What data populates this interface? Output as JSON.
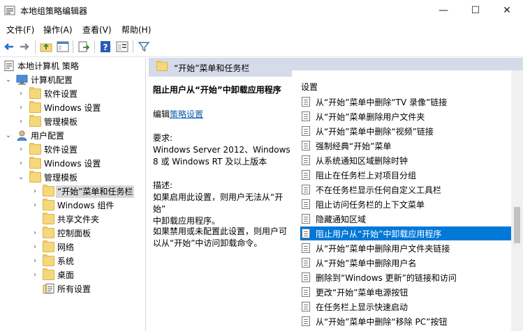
{
  "window": {
    "title": "本地组策略编辑器",
    "controls": {
      "minimize": "—",
      "maximize": "☐",
      "close": "✕"
    }
  },
  "menu": [
    {
      "label": "文件(F)"
    },
    {
      "label": "操作(A)"
    },
    {
      "label": "查看(V)"
    },
    {
      "label": "帮助(H)"
    }
  ],
  "toolbar": {
    "icons": [
      "back-arrow-icon",
      "forward-arrow-icon",
      "up-folder-icon",
      "show-hide-tree-icon",
      "export-list-icon",
      "help-icon",
      "properties-icon",
      "filter-icon"
    ]
  },
  "tree": {
    "items": [
      {
        "label": "本地计算机 策略"
      },
      {
        "label": "计算机配置"
      },
      {
        "label": "软件设置"
      },
      {
        "label": "Windows 设置"
      },
      {
        "label": "管理模板"
      },
      {
        "label": "用户配置"
      },
      {
        "label": "软件设置"
      },
      {
        "label": "Windows 设置"
      },
      {
        "label": "管理模板"
      },
      {
        "label": "“开始”菜单和任务栏"
      },
      {
        "label": "Windows 组件"
      },
      {
        "label": "共享文件夹"
      },
      {
        "label": "控制面板"
      },
      {
        "label": "网络"
      },
      {
        "label": "系统"
      },
      {
        "label": "桌面"
      },
      {
        "label": "所有设置"
      }
    ]
  },
  "right_header": {
    "title": "“开始”菜单和任务栏"
  },
  "description": {
    "title": "阻止用户从“开始”中卸载应用程序",
    "edit_prefix": "编辑",
    "edit_link": "策略设置",
    "req_label": "要求:",
    "req_line1": "Windows Server 2012、Windows",
    "req_line2": "8 或 Windows RT 及以上版本",
    "desc_label": "描述:",
    "desc_line1": "如果启用此设置，则用户无法从“开始”",
    "desc_line2": "中卸载应用程序。",
    "desc2_line1": "如果禁用或未配置此设置，则用户可",
    "desc2_line2": "以从“开始”中访问卸载命令。"
  },
  "settings": {
    "header": "设置",
    "items": [
      {
        "label": "从“开始”菜单中删除“TV 录像”链接"
      },
      {
        "label": "从“开始”菜单删除用户文件夹"
      },
      {
        "label": "从“开始”菜单中删除“视频”链接"
      },
      {
        "label": "强制经典“开始”菜单"
      },
      {
        "label": "从系统通知区域删除时钟"
      },
      {
        "label": "阻止在任务栏上对项目分组"
      },
      {
        "label": "不在任务栏显示任何自定义工具栏"
      },
      {
        "label": "阻止访问任务栏的上下文菜单"
      },
      {
        "label": "隐藏通知区域"
      },
      {
        "label": "阻止用户从“开始”中卸载应用程序"
      },
      {
        "label": "从“开始”菜单中删除用户文件夹链接"
      },
      {
        "label": "从“开始”菜单中删除用户名"
      },
      {
        "label": "删除到“Windows 更新”的链接和访问"
      },
      {
        "label": "更改“开始”菜单电源按钮"
      },
      {
        "label": "在任务栏上显示快速启动"
      },
      {
        "label": "从“开始”菜单中删除“移除 PC”按钮"
      }
    ]
  },
  "colors": {
    "selection": "#0078d7",
    "header_band": "#d6dbe9",
    "link": "#0b5cad",
    "folder": "#f5d77c"
  }
}
